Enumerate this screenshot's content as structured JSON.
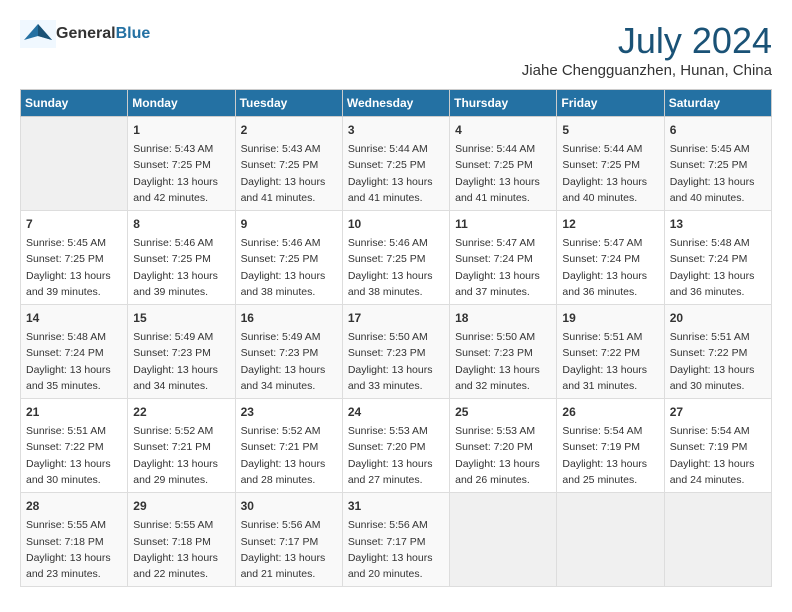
{
  "header": {
    "logo_general": "General",
    "logo_blue": "Blue",
    "month_year": "July 2024",
    "location": "Jiahe Chengguanzhen, Hunan, China"
  },
  "days_of_week": [
    "Sunday",
    "Monday",
    "Tuesday",
    "Wednesday",
    "Thursday",
    "Friday",
    "Saturday"
  ],
  "weeks": [
    {
      "days": [
        {
          "number": "",
          "info": ""
        },
        {
          "number": "1",
          "info": "Sunrise: 5:43 AM\nSunset: 7:25 PM\nDaylight: 13 hours\nand 42 minutes."
        },
        {
          "number": "2",
          "info": "Sunrise: 5:43 AM\nSunset: 7:25 PM\nDaylight: 13 hours\nand 41 minutes."
        },
        {
          "number": "3",
          "info": "Sunrise: 5:44 AM\nSunset: 7:25 PM\nDaylight: 13 hours\nand 41 minutes."
        },
        {
          "number": "4",
          "info": "Sunrise: 5:44 AM\nSunset: 7:25 PM\nDaylight: 13 hours\nand 41 minutes."
        },
        {
          "number": "5",
          "info": "Sunrise: 5:44 AM\nSunset: 7:25 PM\nDaylight: 13 hours\nand 40 minutes."
        },
        {
          "number": "6",
          "info": "Sunrise: 5:45 AM\nSunset: 7:25 PM\nDaylight: 13 hours\nand 40 minutes."
        }
      ]
    },
    {
      "days": [
        {
          "number": "7",
          "info": "Sunrise: 5:45 AM\nSunset: 7:25 PM\nDaylight: 13 hours\nand 39 minutes."
        },
        {
          "number": "8",
          "info": "Sunrise: 5:46 AM\nSunset: 7:25 PM\nDaylight: 13 hours\nand 39 minutes."
        },
        {
          "number": "9",
          "info": "Sunrise: 5:46 AM\nSunset: 7:25 PM\nDaylight: 13 hours\nand 38 minutes."
        },
        {
          "number": "10",
          "info": "Sunrise: 5:46 AM\nSunset: 7:25 PM\nDaylight: 13 hours\nand 38 minutes."
        },
        {
          "number": "11",
          "info": "Sunrise: 5:47 AM\nSunset: 7:24 PM\nDaylight: 13 hours\nand 37 minutes."
        },
        {
          "number": "12",
          "info": "Sunrise: 5:47 AM\nSunset: 7:24 PM\nDaylight: 13 hours\nand 36 minutes."
        },
        {
          "number": "13",
          "info": "Sunrise: 5:48 AM\nSunset: 7:24 PM\nDaylight: 13 hours\nand 36 minutes."
        }
      ]
    },
    {
      "days": [
        {
          "number": "14",
          "info": "Sunrise: 5:48 AM\nSunset: 7:24 PM\nDaylight: 13 hours\nand 35 minutes."
        },
        {
          "number": "15",
          "info": "Sunrise: 5:49 AM\nSunset: 7:23 PM\nDaylight: 13 hours\nand 34 minutes."
        },
        {
          "number": "16",
          "info": "Sunrise: 5:49 AM\nSunset: 7:23 PM\nDaylight: 13 hours\nand 34 minutes."
        },
        {
          "number": "17",
          "info": "Sunrise: 5:50 AM\nSunset: 7:23 PM\nDaylight: 13 hours\nand 33 minutes."
        },
        {
          "number": "18",
          "info": "Sunrise: 5:50 AM\nSunset: 7:23 PM\nDaylight: 13 hours\nand 32 minutes."
        },
        {
          "number": "19",
          "info": "Sunrise: 5:51 AM\nSunset: 7:22 PM\nDaylight: 13 hours\nand 31 minutes."
        },
        {
          "number": "20",
          "info": "Sunrise: 5:51 AM\nSunset: 7:22 PM\nDaylight: 13 hours\nand 30 minutes."
        }
      ]
    },
    {
      "days": [
        {
          "number": "21",
          "info": "Sunrise: 5:51 AM\nSunset: 7:22 PM\nDaylight: 13 hours\nand 30 minutes."
        },
        {
          "number": "22",
          "info": "Sunrise: 5:52 AM\nSunset: 7:21 PM\nDaylight: 13 hours\nand 29 minutes."
        },
        {
          "number": "23",
          "info": "Sunrise: 5:52 AM\nSunset: 7:21 PM\nDaylight: 13 hours\nand 28 minutes."
        },
        {
          "number": "24",
          "info": "Sunrise: 5:53 AM\nSunset: 7:20 PM\nDaylight: 13 hours\nand 27 minutes."
        },
        {
          "number": "25",
          "info": "Sunrise: 5:53 AM\nSunset: 7:20 PM\nDaylight: 13 hours\nand 26 minutes."
        },
        {
          "number": "26",
          "info": "Sunrise: 5:54 AM\nSunset: 7:19 PM\nDaylight: 13 hours\nand 25 minutes."
        },
        {
          "number": "27",
          "info": "Sunrise: 5:54 AM\nSunset: 7:19 PM\nDaylight: 13 hours\nand 24 minutes."
        }
      ]
    },
    {
      "days": [
        {
          "number": "28",
          "info": "Sunrise: 5:55 AM\nSunset: 7:18 PM\nDaylight: 13 hours\nand 23 minutes."
        },
        {
          "number": "29",
          "info": "Sunrise: 5:55 AM\nSunset: 7:18 PM\nDaylight: 13 hours\nand 22 minutes."
        },
        {
          "number": "30",
          "info": "Sunrise: 5:56 AM\nSunset: 7:17 PM\nDaylight: 13 hours\nand 21 minutes."
        },
        {
          "number": "31",
          "info": "Sunrise: 5:56 AM\nSunset: 7:17 PM\nDaylight: 13 hours\nand 20 minutes."
        },
        {
          "number": "",
          "info": ""
        },
        {
          "number": "",
          "info": ""
        },
        {
          "number": "",
          "info": ""
        }
      ]
    }
  ]
}
